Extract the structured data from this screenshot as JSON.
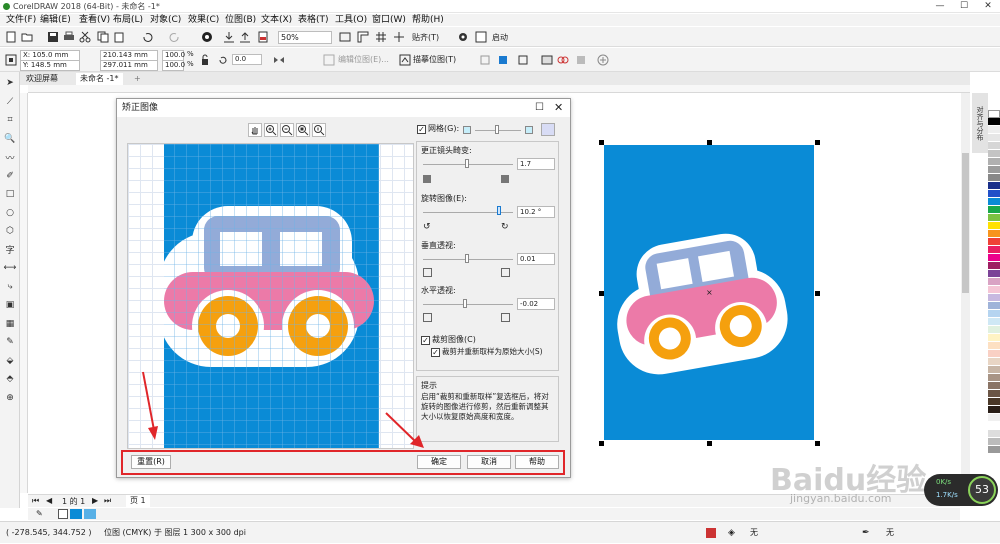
{
  "window": {
    "title": "CorelDRAW 2018 (64-Bit) - 未命名 -1*"
  },
  "menu": [
    "文件(F)",
    "编辑(E)",
    "查看(V)",
    "布局(L)",
    "对象(C)",
    "效果(C)",
    "位图(B)",
    "文本(X)",
    "表格(T)",
    "工具(O)",
    "窗口(W)",
    "帮助(H)"
  ],
  "toolbar": {
    "zoom": "50%",
    "snap_label": "贴齐(T)",
    "launch_label": "启动"
  },
  "propbar": {
    "x": "X: 105.0 mm",
    "y": "Y: 148.5 mm",
    "w": "210.143 mm",
    "h": "297.011 mm",
    "sx": "100.0",
    "sy": "100.0",
    "pct": "%",
    "angle": "0.0",
    "edit_bitmap": "编辑位图(E)...",
    "trace_bitmap": "描摹位图(T)"
  },
  "tabs": {
    "welcome": "欢迎屏幕",
    "doc": "未命名 -1*",
    "add": "+"
  },
  "dialog": {
    "title": "矫正图像",
    "grid_label": "网格(G):",
    "lens_label": "更正镜头畸变:",
    "lens_value": "1.7",
    "rotate_label": "旋转图像(E):",
    "rotate_value": "10.2 °",
    "vpersp_label": "垂直透视:",
    "vpersp_value": "0.01",
    "hpersp_label": "水平透视:",
    "hpersp_value": "-0.02",
    "crop_label": "裁剪图像(C)",
    "crop_resample_label": "裁剪并重新取样为原始大小(S)",
    "tip_title": "提示",
    "tip_text": "启用“裁剪和重新取样”复选框后，将对旋转的图像进行修剪，然后重新调整其大小以恢复原始高度和宽度。",
    "reset": "重置(R)",
    "ok": "确定",
    "cancel": "取消",
    "help": "帮助"
  },
  "page_nav": {
    "pages": "1 的 1",
    "page_tab": "页 1"
  },
  "status": {
    "coords": "( -278.545, 344.752 )",
    "info": "位图 (CMYK) 于 图层 1 300 x 300 dpi",
    "fill_none": "无",
    "outline_none": "无"
  },
  "side_dock": {
    "label": "对齐与分布"
  },
  "colors": {
    "accent": "#0a8bd6",
    "pink": "#ec7aa8",
    "orange": "#f5a00e",
    "window": "#93abd8",
    "red_box": "#e0262a"
  },
  "watermark": {
    "brand": "Baidu经验",
    "url": "jingyan.baidu.com"
  },
  "net_widget": {
    "up": "0K/s",
    "down": "1.7K/s",
    "percent": "53"
  }
}
